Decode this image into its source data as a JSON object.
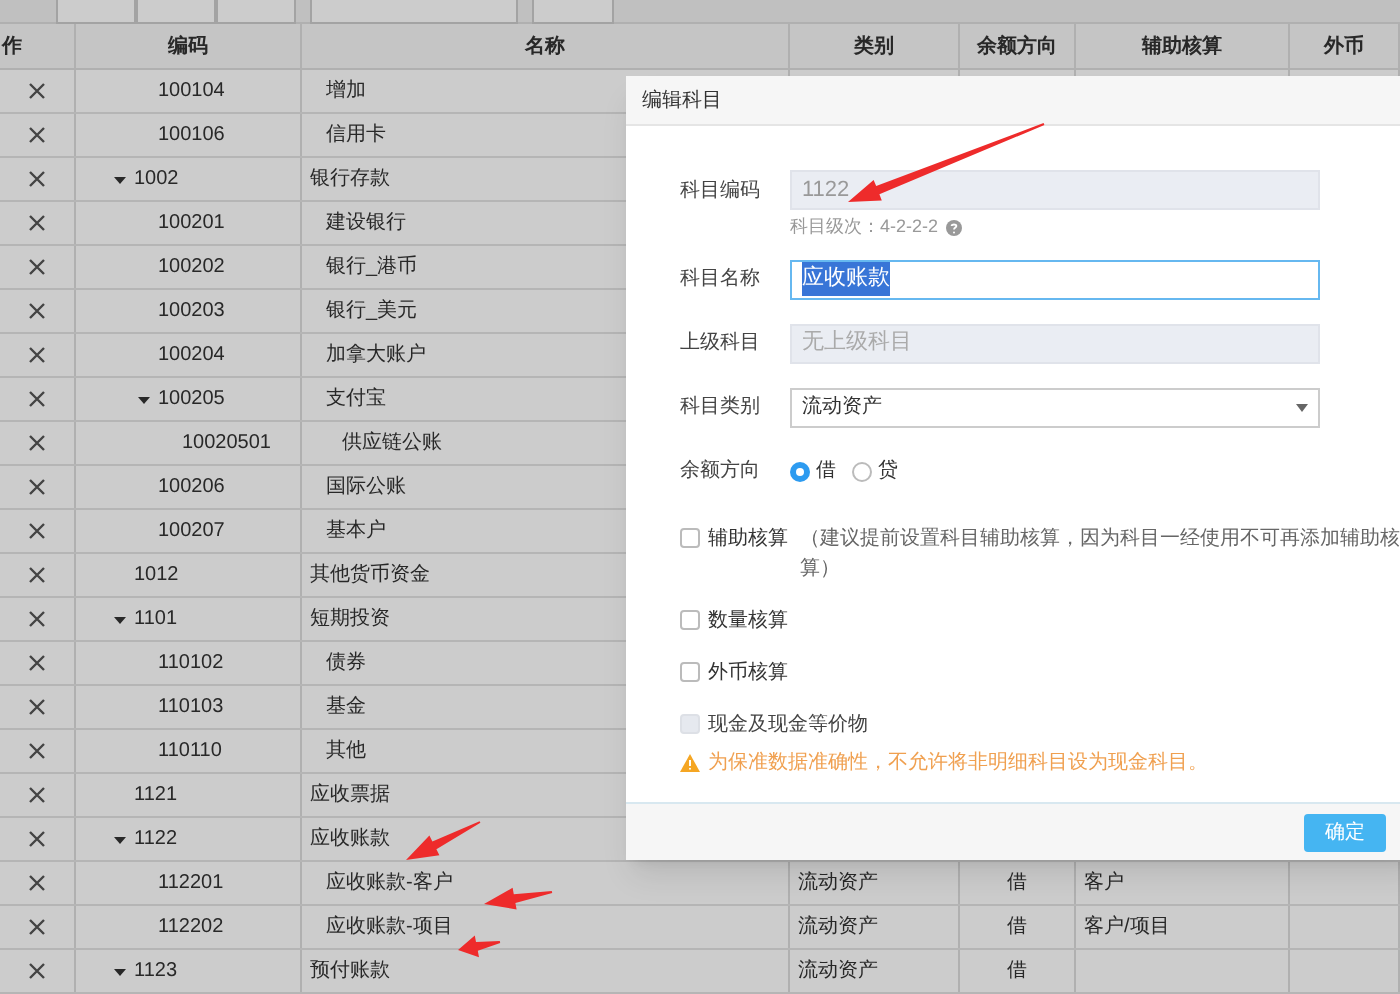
{
  "table": {
    "columns": [
      "作",
      "编码",
      "名称",
      "类别",
      "余额方向",
      "辅助核算",
      "外币"
    ],
    "rows": [
      {
        "children": [
          {
            "code": "100104",
            "name": "增加"
          },
          {
            "code": "100106",
            "name": "信用卡"
          }
        ]
      },
      {
        "code": "1002",
        "name": "银行存款",
        "expanded": true,
        "children": [
          {
            "code": "100201",
            "name": "建设银行"
          },
          {
            "code": "100202",
            "name": "银行_港币"
          },
          {
            "code": "100203",
            "name": "银行_美元"
          },
          {
            "code": "100204",
            "name": "加拿大账户"
          },
          {
            "code": "100205",
            "name": "支付宝",
            "expanded": true,
            "children": [
              {
                "code": "10020501",
                "name": "供应链公账"
              }
            ]
          },
          {
            "code": "100206",
            "name": "国际公账"
          },
          {
            "code": "100207",
            "name": "基本户"
          }
        ]
      },
      {
        "code": "1012",
        "name": "其他货币资金"
      },
      {
        "code": "1101",
        "name": "短期投资",
        "expanded": true,
        "children": [
          {
            "code": "110102",
            "name": "债券"
          },
          {
            "code": "110103",
            "name": "基金"
          },
          {
            "code": "110110",
            "name": "其他"
          }
        ]
      },
      {
        "code": "1121",
        "name": "应收票据"
      },
      {
        "code": "1122",
        "name": "应收账款",
        "expanded": true,
        "children": [
          {
            "code": "112201",
            "name": "应收账款-客户",
            "type": "流动资产",
            "direction": "借",
            "aux": "客户"
          },
          {
            "code": "112202",
            "name": "应收账款-项目",
            "type": "流动资产",
            "direction": "借",
            "aux": "客户/项目"
          }
        ]
      },
      {
        "code": "1123",
        "name": "预付账款",
        "expanded": true,
        "type": "流动资产",
        "direction": "借"
      }
    ]
  },
  "dialog": {
    "title": "编辑科目",
    "fields": [
      {
        "kind": "text",
        "label": "科目编码",
        "value": "1122",
        "disabled": true,
        "hint": "科目级次：4-2-2-2"
      },
      {
        "kind": "text",
        "label": "科目名称",
        "value": "应收账款",
        "disabled": false,
        "focused": true
      },
      {
        "kind": "text",
        "label": "上级科目",
        "placeholder": "无上级科目",
        "disabled": true
      },
      {
        "kind": "select",
        "label": "科目类别",
        "value": "流动资产"
      },
      {
        "kind": "radio",
        "label": "余额方向",
        "options": [
          {
            "label": "借",
            "selected": true
          },
          {
            "label": "贷",
            "selected": false
          }
        ]
      }
    ],
    "checkboxes": [
      {
        "label": "辅助核算",
        "note": "（建议提前设置科目辅助核算，因为科目一经使用不可再添加辅助核算）",
        "checked": false,
        "disabled": false
      },
      {
        "label": "数量核算",
        "checked": false,
        "disabled": false
      },
      {
        "label": "外币核算",
        "checked": false,
        "disabled": false
      },
      {
        "label": "现金及现金等价物",
        "checked": false,
        "disabled": true
      }
    ],
    "warning": "为保准数据准确性，不允许将非明细科目设为现金科目。",
    "button": "确定"
  }
}
